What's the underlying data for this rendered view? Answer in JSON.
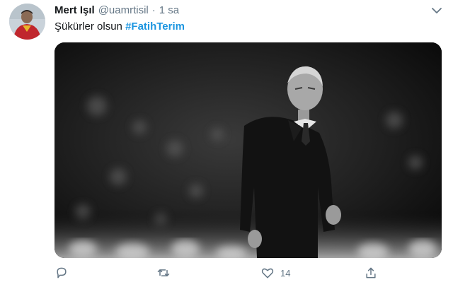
{
  "tweet": {
    "author_name": "Mert Işıl",
    "author_handle": "@uamrtisil",
    "separator": "·",
    "timestamp": "1 sa",
    "text_prefix": "Şükürler olsun ",
    "hashtag": "#FatihTerim",
    "like_count": "14"
  },
  "icons": {
    "menu": "chevron-down-icon",
    "reply": "reply-icon",
    "retweet": "retweet-icon",
    "like": "heart-icon",
    "share": "share-icon"
  },
  "colors": {
    "hashtag": "#1b95e0",
    "secondary_text": "#657786"
  }
}
